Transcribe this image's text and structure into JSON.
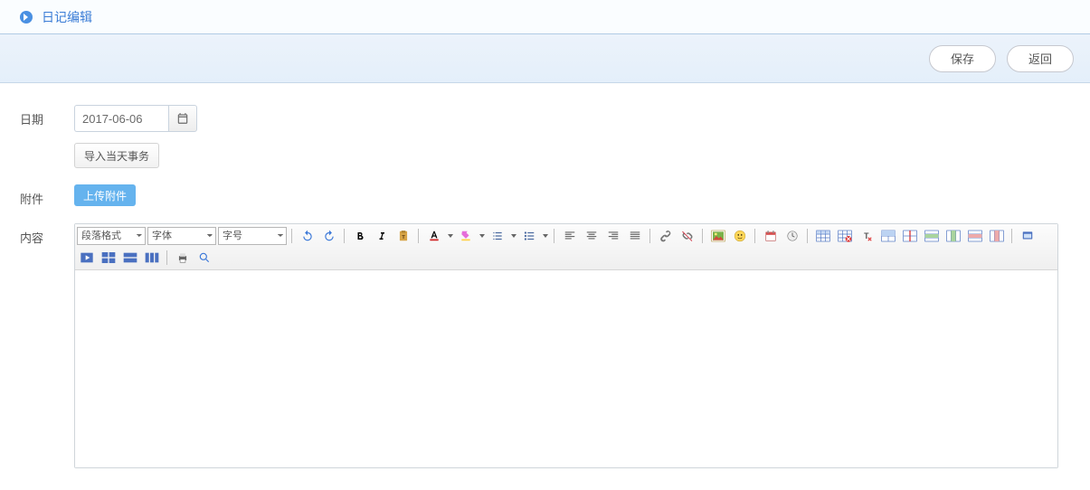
{
  "header": {
    "title": "日记编辑"
  },
  "actions": {
    "save": "保存",
    "back": "返回"
  },
  "form": {
    "date_label": "日期",
    "date_value": "2017-06-06",
    "import_today": "导入当天事务",
    "attach_label": "附件",
    "upload_attach": "上传附件",
    "content_label": "内容"
  },
  "editor": {
    "block_format": "段落格式",
    "font_family": "字体",
    "font_size": "字号"
  }
}
